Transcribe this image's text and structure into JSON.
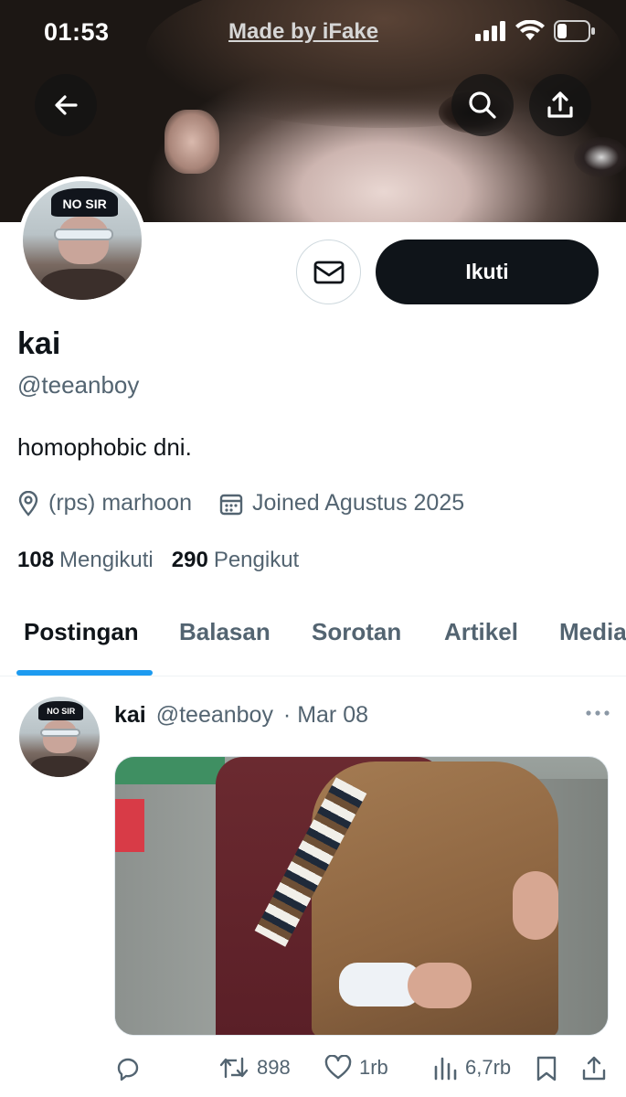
{
  "status_bar": {
    "time": "01:53",
    "carrier": "Made by iFake"
  },
  "profile": {
    "name": "kai",
    "handle": "@teeanboy",
    "bio": "homophobic dni.",
    "location": "(rps) marhoon",
    "joined": "Joined Agustus 2025",
    "following_count": "108",
    "following_label": "Mengikuti",
    "followers_count": "290",
    "followers_label": "Pengikut",
    "avatar_cap_text": "NO SIR"
  },
  "actions": {
    "follow_label": "Ikuti"
  },
  "tabs": [
    {
      "label": "Postingan",
      "active": true
    },
    {
      "label": "Balasan",
      "active": false
    },
    {
      "label": "Sorotan",
      "active": false
    },
    {
      "label": "Artikel",
      "active": false
    },
    {
      "label": "Media",
      "active": false
    }
  ],
  "post": {
    "author_name": "kai",
    "author_handle": "@teeanboy",
    "date": "· Mar 08",
    "retweets": "898",
    "likes": "1rb",
    "views": "6,7rb",
    "avatar_cap_text": "NO SIR"
  },
  "colors": {
    "accent": "#1d9bf0",
    "text_primary": "#0f1419",
    "text_secondary": "#536471",
    "button_dark": "#0f1419"
  }
}
